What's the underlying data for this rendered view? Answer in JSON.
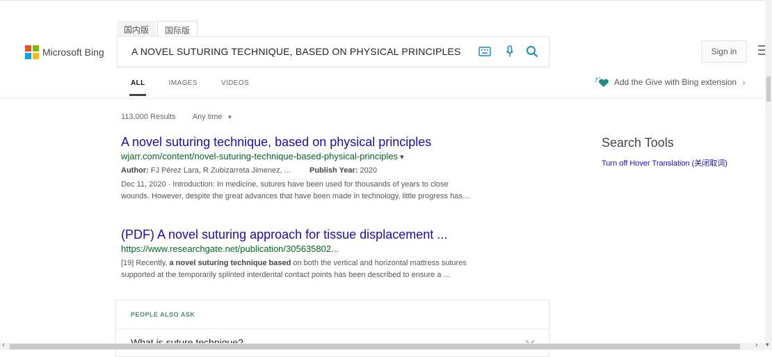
{
  "colors": {
    "link": "#1a0dab",
    "url": "#006621",
    "paa_title": "#4b8a7a"
  },
  "header": {
    "logo_text": "Microsoft Bing",
    "region_tabs": [
      {
        "label": "国内版",
        "active": false
      },
      {
        "label": "国际版",
        "active": true
      }
    ],
    "search_value": "A NOVEL SUTURING TECHNIQUE, BASED ON PHYSICAL PRINCIPLES",
    "signin_label": "Sign in"
  },
  "nav": {
    "items": [
      {
        "label": "ALL",
        "active": true
      },
      {
        "label": "IMAGES",
        "active": false
      },
      {
        "label": "VIDEOS",
        "active": false
      }
    ],
    "give_extension": "Add the Give with Bing extension"
  },
  "results_meta": {
    "count": "113,000 Results",
    "time_filter": "Any time"
  },
  "results": [
    {
      "title": "A novel suturing technique, based on physical principles",
      "url": "wjarr.com/content/novel-suturing-technique-based-physical-principles",
      "author_label": "Author:",
      "author_value": "FJ Pérez Lara, R Zubizarreta Jimenez, ...",
      "year_label": "Publish Year:",
      "year_value": "2020",
      "snippet_1": "Dec 11, 2020 · Introduction: In medicine, sutures have been used for thousands of years to close",
      "snippet_2": "wounds. However, despite the great advances that have been made in technology, little progress has…"
    },
    {
      "title": "(PDF) A novel suturing approach for tissue displacement ...",
      "url": "https://www.researchgate.net/publication/305635802...",
      "snippet_pre": "[19] Recently, ",
      "snippet_bold": "a novel suturing technique based",
      "snippet_post": " on both the vertical and horizontal mattress sutures",
      "snippet_2": "supported at the temporarily splinted interdental contact points has been described to ensure a ..."
    }
  ],
  "paa": {
    "title": "PEOPLE ALSO ASK",
    "question": "What is suture technique?"
  },
  "sidebar": {
    "title": "Search Tools",
    "link": "Turn off Hover Translation (关闭取词)"
  }
}
